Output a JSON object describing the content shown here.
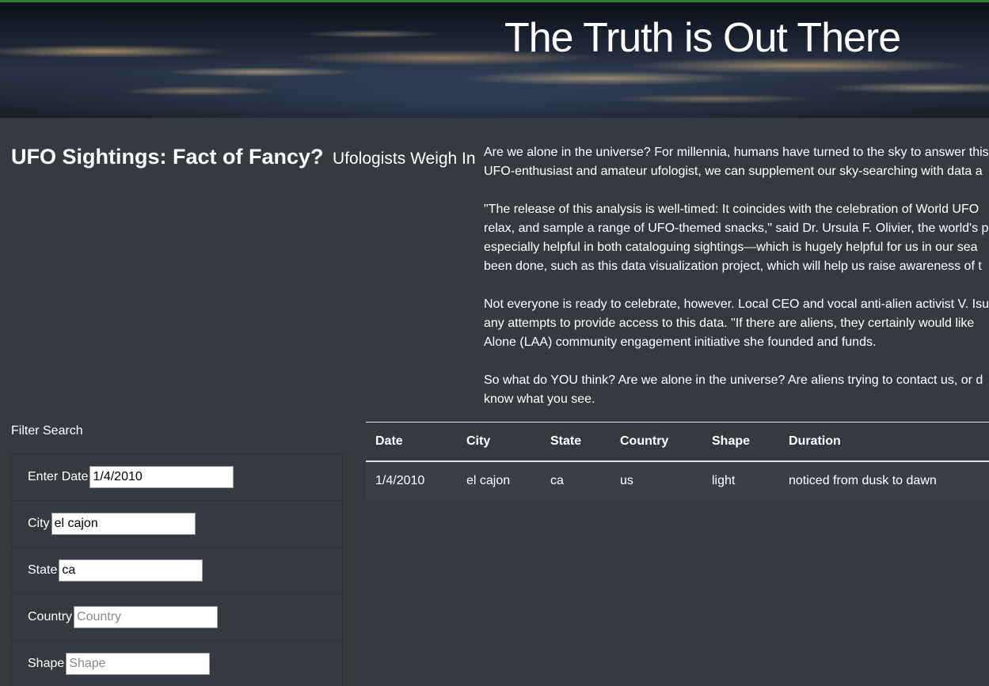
{
  "hero": {
    "title": "The Truth is Out There"
  },
  "headline": {
    "title": "UFO Sightings: Fact of Fancy?",
    "subtitle": "Ufologists Weigh In"
  },
  "article": {
    "paragraphs": [
      "Are we alone in the universe? For millennia, humans have turned to the sky to answer this UFO-enthusiast and amateur ufologist, we can supplement our sky-searching with data a",
      "\"The release of this analysis is well-timed: It coincides with the celebration of World UFO relax, and sample a range of UFO-themed snacks,\" said Dr. Ursula F. Olivier, the world's p especially helpful in both cataloguing sightings—which is hugely helpful for us in our sea been done, such as this data visualization project, which will help us raise awareness of t",
      "Not everyone is ready to celebrate, however. Local CEO and vocal anti-alien activist V. Isu any attempts to provide access to this data. \"If there are aliens, they certainly would like Alone (LAA) community engagement initiative she founded and funds.",
      "So what do YOU think? Are we alone in the universe? Are aliens trying to contact us, or d know what you see."
    ],
    "lines": [
      [
        "Are we alone in the universe? For millennia, humans have turned to the sky to answer this",
        "UFO-enthusiast and amateur ufologist, we can supplement our sky-searching with data a"
      ],
      [
        "\"The release of this analysis is well-timed: It coincides with the celebration of World UFO",
        "relax, and sample a range of UFO-themed snacks,\" said Dr. Ursula F. Olivier, the world's p",
        "especially helpful in both cataloguing sightings—which is hugely helpful for us in our sea",
        "been done, such as this data visualization project, which will help us raise awareness of t"
      ],
      [
        "Not everyone is ready to celebrate, however. Local CEO and vocal anti-alien activist V. Isu",
        "any attempts to provide access to this data. \"If there are aliens, they certainly would like",
        "Alone (LAA) community engagement initiative she founded and funds."
      ],
      [
        "So what do YOU think? Are we alone in the universe? Are aliens trying to contact us, or d",
        "know what you see."
      ]
    ]
  },
  "filters": {
    "title": "Filter Search",
    "date": {
      "label": "Enter Date",
      "value": "1/4/2010",
      "placeholder": ""
    },
    "city": {
      "label": "City",
      "value": "el cajon",
      "placeholder": ""
    },
    "state": {
      "label": "State",
      "value": "ca",
      "placeholder": ""
    },
    "country": {
      "label": "Country",
      "value": "",
      "placeholder": "Country"
    },
    "shape": {
      "label": "Shape",
      "value": "",
      "placeholder": "Shape"
    }
  },
  "table": {
    "headers": [
      "Date",
      "City",
      "State",
      "Country",
      "Shape",
      "Duration"
    ],
    "rows": [
      [
        "1/4/2010",
        "el cajon",
        "ca",
        "us",
        "light",
        "noticed from dusk to dawn"
      ]
    ]
  }
}
